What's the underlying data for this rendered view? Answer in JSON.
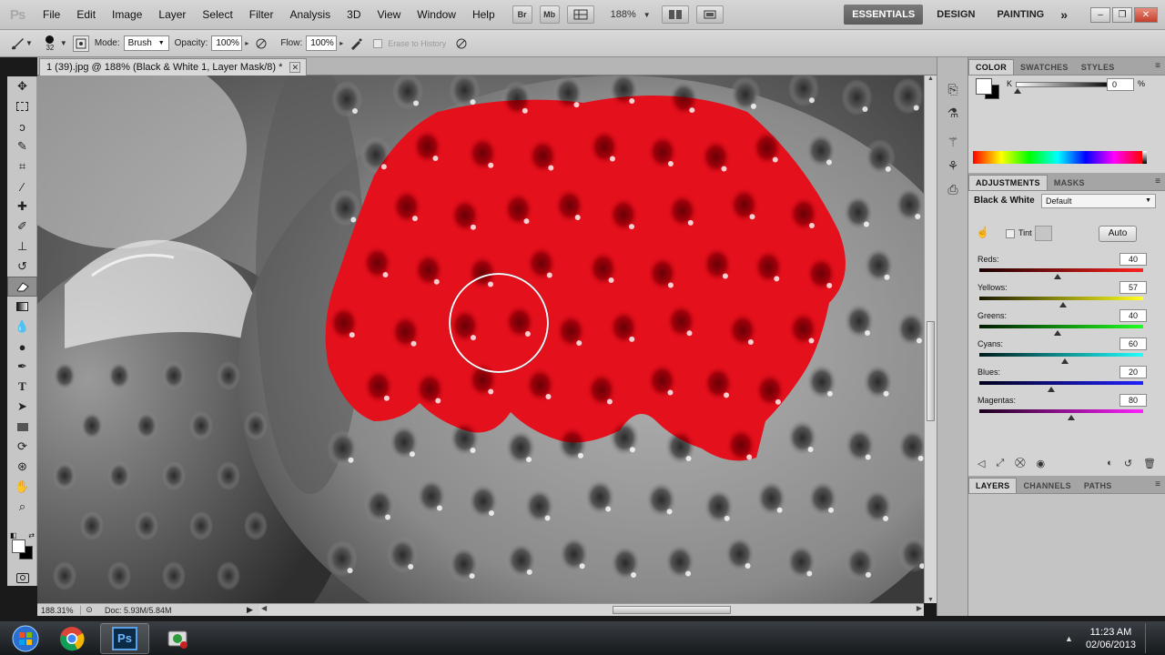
{
  "app": {
    "logo": "Ps",
    "zoom": "188%"
  },
  "menu": [
    "File",
    "Edit",
    "Image",
    "Layer",
    "Select",
    "Filter",
    "Analysis",
    "3D",
    "View",
    "Window",
    "Help"
  ],
  "menubar_buttons": [
    "Br",
    "Mb"
  ],
  "workspaces": {
    "active": "ESSENTIALS",
    "others": [
      "DESIGN",
      "PAINTING"
    ],
    "more": "»"
  },
  "options": {
    "brush_size": "32",
    "mode_label": "Mode:",
    "mode_value": "Brush",
    "opacity_label": "Opacity:",
    "opacity_value": "100%",
    "flow_label": "Flow:",
    "flow_value": "100%",
    "erase_history": "Erase to History"
  },
  "document": {
    "tab_title": "1 (39).jpg @ 188% (Black & White 1, Layer Mask/8) *",
    "zoom_status": "188.31%",
    "doc_size": "Doc: 5.93M/5.84M"
  },
  "panels": {
    "color_tabs": [
      "COLOR",
      "SWATCHES",
      "STYLES"
    ],
    "color_channel": "K",
    "color_value": "0",
    "color_unit": "%",
    "adjustment_tabs": [
      "ADJUSTMENTS",
      "MASKS"
    ],
    "adjustment_title": "Black & White",
    "preset": "Default",
    "tint_label": "Tint",
    "auto_label": "Auto",
    "layers_tabs": [
      "LAYERS",
      "CHANNELS",
      "PATHS"
    ]
  },
  "sliders": [
    {
      "label": "Reds:",
      "value": "40",
      "fraction": 0.48,
      "gradient": "linear-gradient(90deg,#1a0000,#ff2020)"
    },
    {
      "label": "Yellows:",
      "value": "57",
      "fraction": 0.51,
      "gradient": "linear-gradient(90deg,#1a1a00,#ffff20)"
    },
    {
      "label": "Greens:",
      "value": "40",
      "fraction": 0.48,
      "gradient": "linear-gradient(90deg,#001a00,#20ff20)"
    },
    {
      "label": "Cyans:",
      "value": "60",
      "fraction": 0.52,
      "gradient": "linear-gradient(90deg,#001a1a,#20ffff)"
    },
    {
      "label": "Blues:",
      "value": "20",
      "fraction": 0.44,
      "gradient": "linear-gradient(90deg,#00001a,#2020ff)"
    },
    {
      "label": "Magentas:",
      "value": "80",
      "fraction": 0.56,
      "gradient": "linear-gradient(90deg,#1a001a,#ff20ff)"
    }
  ],
  "taskbar": {
    "time": "11:23 AM",
    "date": "02/06/2013"
  },
  "colors": {
    "mask_red": "#e4101c",
    "chrome": "#c8c8c8",
    "workspace_active": "#6a6a6a"
  }
}
